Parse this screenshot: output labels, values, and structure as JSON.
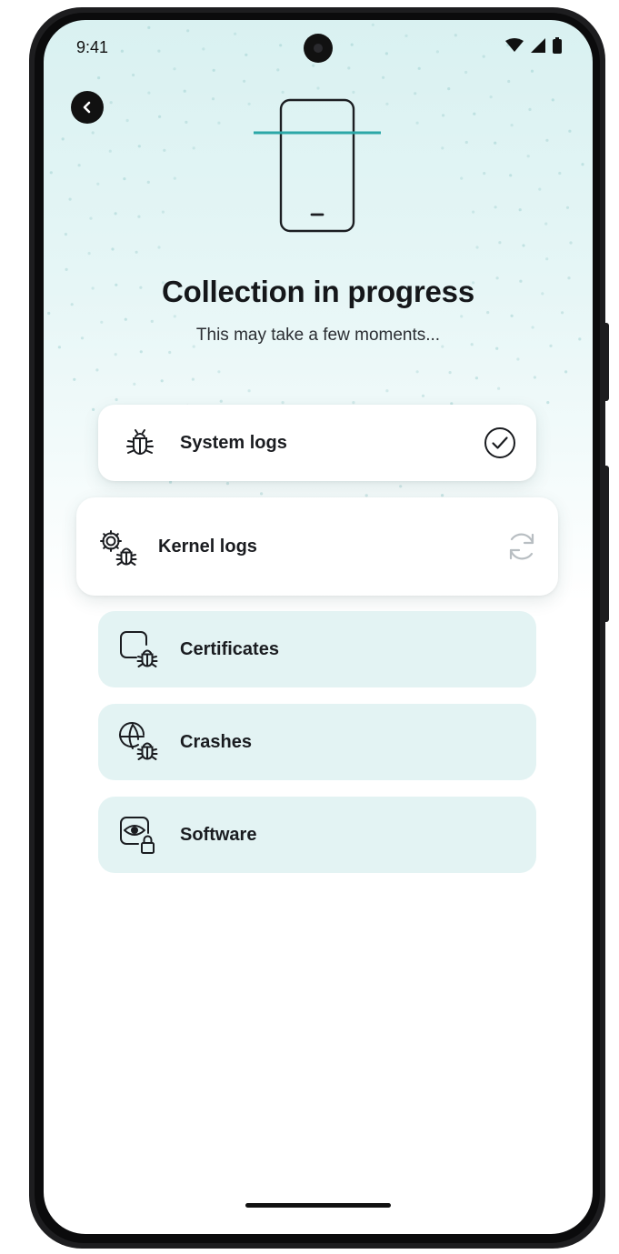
{
  "status_bar": {
    "time": "9:41"
  },
  "header": {
    "back_icon": "chevron-left-icon"
  },
  "hero": {
    "illustration": "phone-scan-icon",
    "title": "Collection in progress",
    "subtitle": "This may take a few moments..."
  },
  "items": [
    {
      "label": "System logs",
      "icon": "bug-icon",
      "state": "done",
      "status_icon": "check-circle-icon"
    },
    {
      "label": "Kernel logs",
      "icon": "gear-bug-icon",
      "state": "in-progress",
      "status_icon": "sync-icon"
    },
    {
      "label": "Certificates",
      "icon": "certificate-bug-icon",
      "state": "pending"
    },
    {
      "label": "Crashes",
      "icon": "globe-bug-icon",
      "state": "pending"
    },
    {
      "label": "Software",
      "icon": "eye-lock-icon",
      "state": "pending"
    }
  ],
  "colors": {
    "accent": "#2ba7a7",
    "pending_card": "#e3f3f3",
    "text": "#1a1c20"
  }
}
